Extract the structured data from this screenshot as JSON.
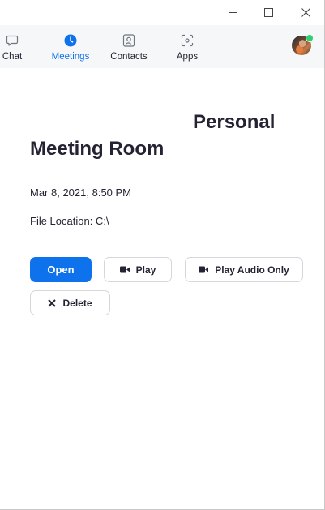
{
  "window": {
    "controls": {
      "minimize": "minimize-icon",
      "maximize": "maximize-icon",
      "close": "close-icon"
    }
  },
  "nav": {
    "items": [
      {
        "label": "Chat",
        "icon": "chat-icon",
        "active": false
      },
      {
        "label": "Meetings",
        "icon": "clock-icon",
        "active": true
      },
      {
        "label": "Contacts",
        "icon": "contacts-icon",
        "active": false
      },
      {
        "label": "Apps",
        "icon": "apps-icon",
        "active": false
      }
    ],
    "profile": {
      "avatar": "user-avatar",
      "presence": "online"
    }
  },
  "recording": {
    "title_line1": "Personal",
    "title_line2": "Meeting Room",
    "date": "Mar 8, 2021, 8:50 PM",
    "file_location": "File Location: C:\\"
  },
  "actions": {
    "open": "Open",
    "play": "Play",
    "play_audio_only": "Play Audio Only",
    "delete": "Delete"
  },
  "colors": {
    "accent": "#0e72ed",
    "text": "#232333",
    "nav_background": "#f6f7f9",
    "presence": "#2bd16e"
  }
}
